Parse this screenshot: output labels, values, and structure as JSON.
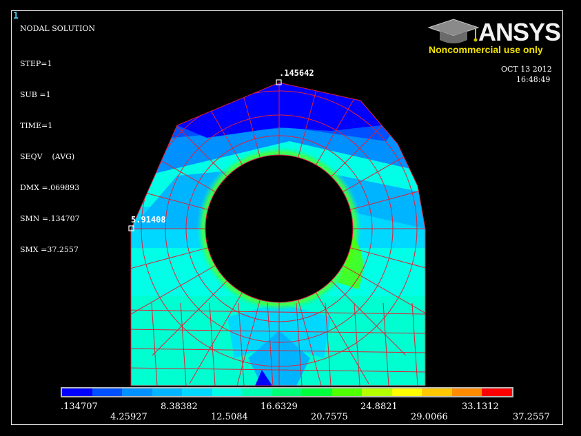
{
  "window_number": "1",
  "plot_title": "NODAL SOLUTION",
  "info_lines": [
    "STEP=1",
    "SUB =1",
    "TIME=1",
    "SEQV    (AVG)",
    "DMX =.069893",
    "SMN =.134707",
    "SMX =37.2557"
  ],
  "logo": {
    "brand": "ANSYS",
    "tagline": "Noncommercial use only",
    "icon": "graduation-cap-icon"
  },
  "date": "OCT 13 2012",
  "time": "16:48:49",
  "markers": {
    "top_value": ".145642",
    "left_value": "5.91408"
  },
  "legend": {
    "colors": [
      "#0000ff",
      "#0050ff",
      "#0090ff",
      "#00b4ff",
      "#00d8ff",
      "#00ffe6",
      "#00ffb4",
      "#00ff78",
      "#00ff3c",
      "#50ff00",
      "#b4ff00",
      "#ffff00",
      "#ffc800",
      "#ff8c00",
      "#ff0000"
    ],
    "labels_top": [
      ".134707",
      "8.38382",
      "16.6329",
      "24.8821",
      "33.1312"
    ],
    "labels_bottom": [
      "4.25927",
      "12.5084",
      "20.7575",
      "29.0066",
      "37.2557"
    ]
  },
  "colors": {
    "background": "#000000",
    "mesh_lines": "#e0203a",
    "frame": "#e8e8e8"
  }
}
